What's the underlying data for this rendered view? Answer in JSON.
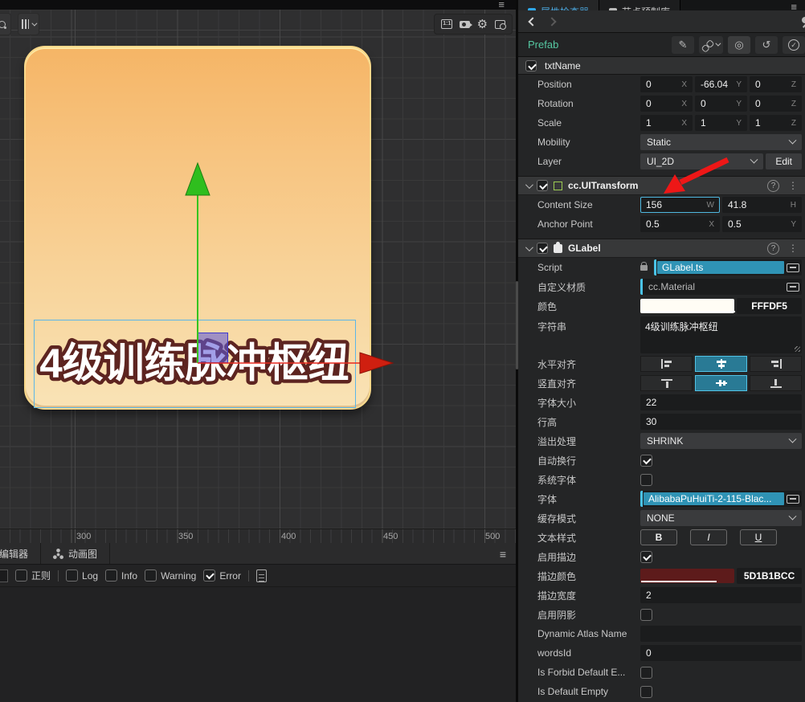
{
  "scene": {
    "card": {
      "text": "4级训练脉冲枢纽",
      "text_color": "#FFFFFF",
      "outline_color": "#5D2420"
    },
    "ruler_ticks": [
      "300",
      "350",
      "400",
      "450",
      "500"
    ],
    "top_toolbar_icons": [
      "aspect-ratio",
      "camera",
      "gear",
      "image-settings"
    ],
    "accent_colors": {
      "selection": "#5BB6E8",
      "axis_y": "#35C41F",
      "axis_x": "#D6281A",
      "anchor": "#5F5AD7"
    }
  },
  "console": {
    "tabs": [
      {
        "label": "编辑器"
      },
      {
        "label": "动画图"
      }
    ],
    "regex_label": "正则",
    "filters": [
      {
        "label": "Log",
        "checked": false
      },
      {
        "label": "Info",
        "checked": false
      },
      {
        "label": "Warning",
        "checked": false
      },
      {
        "label": "Error",
        "checked": true
      }
    ]
  },
  "inspector": {
    "tabs": [
      {
        "label": "属性检查器",
        "active": true
      },
      {
        "label": "节点预制库",
        "active": false
      }
    ],
    "prefab": {
      "label": "Prefab",
      "buttons": [
        "edit",
        "unlink",
        "locate",
        "revert",
        "apply"
      ]
    },
    "node": {
      "name": "txtName",
      "checked": true
    },
    "transform": {
      "position": {
        "label": "Position",
        "x": "0",
        "y": "-66.04",
        "z": "0"
      },
      "rotation": {
        "label": "Rotation",
        "x": "0",
        "y": "0",
        "z": "0"
      },
      "scale": {
        "label": "Scale",
        "x": "1",
        "y": "1",
        "z": "1"
      },
      "mobility": {
        "label": "Mobility",
        "value": "Static"
      },
      "layer": {
        "label": "Layer",
        "value": "UI_2D",
        "edit_label": "Edit"
      },
      "suffixes": {
        "x": "X",
        "y": "Y",
        "z": "Z",
        "w": "W",
        "h": "H"
      }
    },
    "uitransform": {
      "title": "cc.UITransform",
      "content_size": {
        "label": "Content Size",
        "w": "156",
        "h": "41.8"
      },
      "anchor_point": {
        "label": "Anchor Point",
        "x": "0.5",
        "y": "0.5"
      }
    },
    "glabel": {
      "title": "GLabel",
      "script": {
        "label": "Script",
        "value": "GLabel.ts"
      },
      "material": {
        "label": "自定义材质",
        "value": "cc.Material"
      },
      "color": {
        "label": "颜色",
        "hex": "FFFDF5",
        "swatch": "#FFFDF5"
      },
      "string": {
        "label": "字符串",
        "value": "4级训练脉冲枢纽"
      },
      "h_align": {
        "label": "水平对齐",
        "selected": "center"
      },
      "v_align": {
        "label": "竖直对齐",
        "selected": "middle"
      },
      "font_size": {
        "label": "字体大小",
        "value": "22"
      },
      "line_height": {
        "label": "行高",
        "value": "30"
      },
      "overflow": {
        "label": "溢出处理",
        "value": "SHRINK"
      },
      "wrap": {
        "label": "自动换行",
        "checked": true
      },
      "system_font": {
        "label": "系统字体",
        "checked": false
      },
      "font": {
        "label": "字体",
        "value": "AlibabaPuHuiTi-2-115-Blac..."
      },
      "cache_mode": {
        "label": "缓存模式",
        "value": "NONE"
      },
      "text_style": {
        "label": "文本样式",
        "bold": "B",
        "italic": "I",
        "underline": "U"
      },
      "outline_enable": {
        "label": "启用描边",
        "checked": true
      },
      "outline_color": {
        "label": "描边颜色",
        "hex": "5D1B1BCC",
        "swatch": "#5D1B1B",
        "alpha_pct": 80
      },
      "outline_width": {
        "label": "描边宽度",
        "value": "2"
      },
      "shadow_enable": {
        "label": "启用阴影",
        "checked": false
      },
      "dynamic_atlas": {
        "label": "Dynamic Atlas Name",
        "value": ""
      },
      "words_id": {
        "label": "wordsId",
        "value": "0"
      },
      "is_forbid_default": {
        "label": "Is Forbid Default E...",
        "checked": false
      },
      "is_default_empty": {
        "label": "Is Default Empty",
        "checked": false
      }
    }
  }
}
